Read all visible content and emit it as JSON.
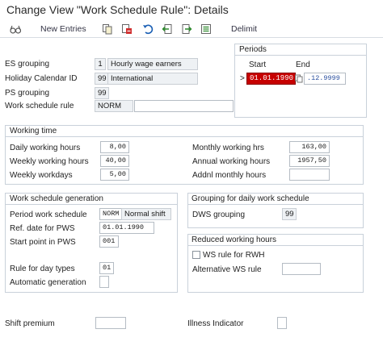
{
  "window": {
    "title": "Change View \"Work Schedule Rule\": Details"
  },
  "toolbar": {
    "new_entries": "New Entries",
    "delimit": "Delimit",
    "icons": [
      "glasses-icon",
      "copy-icon",
      "delete-icon",
      "undo-icon",
      "previous-entry-icon",
      "next-entry-icon",
      "select-all-icon"
    ]
  },
  "header": {
    "es_grouping": {
      "label": "ES grouping",
      "value": "1",
      "text": "Hourly wage earners"
    },
    "holiday_calendar": {
      "label": "Holiday Calendar ID",
      "value": "99",
      "text": "International"
    },
    "ps_grouping": {
      "label": "PS grouping",
      "value": "99"
    },
    "work_schedule_rule": {
      "label": "Work schedule rule",
      "value": "NORM",
      "text": ""
    }
  },
  "periods": {
    "title": "Periods",
    "start_label": "Start",
    "end_label": "End",
    "marker": ">",
    "start_value": "01.01.1990",
    "end_value": ".12.9999"
  },
  "working_time": {
    "title": "Working time",
    "daily_hours": {
      "label": "Daily working hours",
      "value": "8,00"
    },
    "weekly_hours": {
      "label": "Weekly working hours",
      "value": "40,00"
    },
    "weekly_workdays": {
      "label": "Weekly workdays",
      "value": "5,00"
    },
    "monthly_hours": {
      "label": "Monthly working hrs",
      "value": "163,00"
    },
    "annual_hours": {
      "label": "Annual working hours",
      "value": "1957,50"
    },
    "addnl_monthly": {
      "label": "Addnl monthly hours",
      "value": ""
    }
  },
  "ws_generation": {
    "title": "Work schedule generation",
    "period_ws": {
      "label": "Period work schedule",
      "value": "NORM",
      "text": "Normal shift"
    },
    "ref_date": {
      "label": "Ref. date for PWS",
      "value": "01.01.1990"
    },
    "start_point": {
      "label": "Start point in PWS",
      "value": "001"
    },
    "rule_day_types": {
      "label": "Rule for day types",
      "value": "01"
    },
    "auto_generation": {
      "label": "Automatic generation",
      "checked": false
    }
  },
  "dws_grouping": {
    "title": "Grouping for daily work schedule",
    "label": "DWS grouping",
    "value": "99"
  },
  "reduced_hours": {
    "title": "Reduced working hours",
    "ws_rule_rwh": {
      "label": "WS rule for RWH",
      "checked": false
    },
    "alt_ws_rule": {
      "label": "Alternative WS rule",
      "value": ""
    }
  },
  "footer": {
    "shift_premium": {
      "label": "Shift premium",
      "value": ""
    },
    "illness_indicator": {
      "label": "Illness Indicator",
      "value": ""
    }
  },
  "colors": {
    "error_highlight": "#c70000",
    "group_border": "#c9d1da",
    "readonly_bg": "#eef1f4"
  }
}
